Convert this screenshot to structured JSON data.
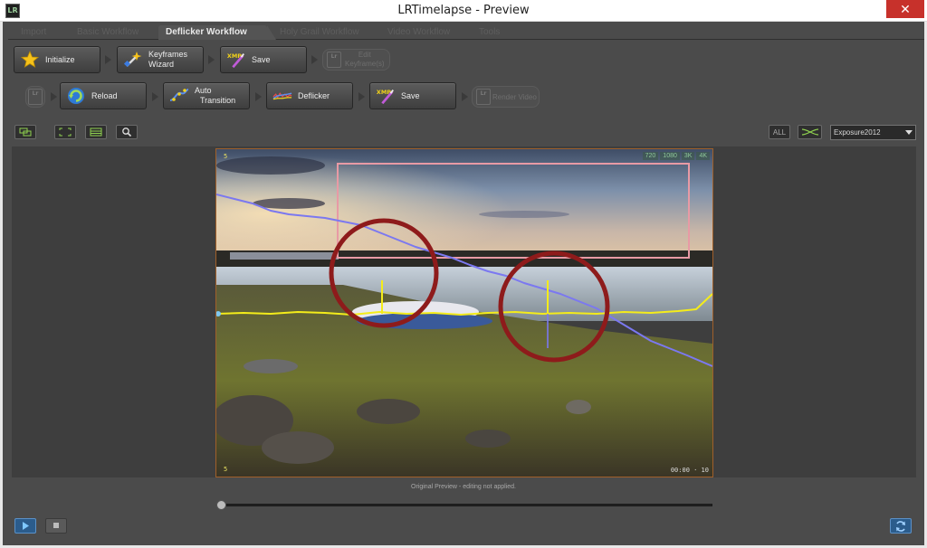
{
  "window": {
    "title": "LRTimelapse - Preview",
    "app_icon": "LR",
    "close_glyph": "✕"
  },
  "tabs": [
    {
      "label": "Import"
    },
    {
      "label": "Basic Workflow"
    },
    {
      "label": "Deflicker Workflow",
      "active": true
    },
    {
      "label": "Holy Grail Workflow"
    },
    {
      "label": "Video Workflow"
    },
    {
      "label": "Tools"
    }
  ],
  "row1": {
    "initialize": "Initialize",
    "keyframes_line1": "Keyframes",
    "keyframes_line2": "Wizard",
    "save": "Save",
    "edit_line1": "Edit",
    "edit_line2": "Keyframe(s)"
  },
  "row2": {
    "reload": "Reload",
    "auto_line1": "Auto",
    "auto_line2": "Transition",
    "deflicker": "Deflicker",
    "save": "Save",
    "render": "Render Video"
  },
  "xmp_tag": "XMP",
  "lr_tag": "Lr",
  "toolbar": {
    "all_label": "ALL",
    "dropdown_value": "Exposure2012"
  },
  "preview": {
    "resolutions": [
      "720",
      "1080",
      "3K",
      "4K"
    ],
    "corner_top": "5",
    "corner_bottom": "5",
    "timecode": "00:00 · 10",
    "status": "Original Preview - editing not applied."
  },
  "colors": {
    "exposure_curve": "#7b78f0",
    "luminance_curve": "#f4ec1a",
    "highlight_circle": "#8e1b1b",
    "crop_rect": "#e89aa5",
    "accent_blue": "#2b5c8c"
  },
  "playback": {
    "position": 0
  }
}
